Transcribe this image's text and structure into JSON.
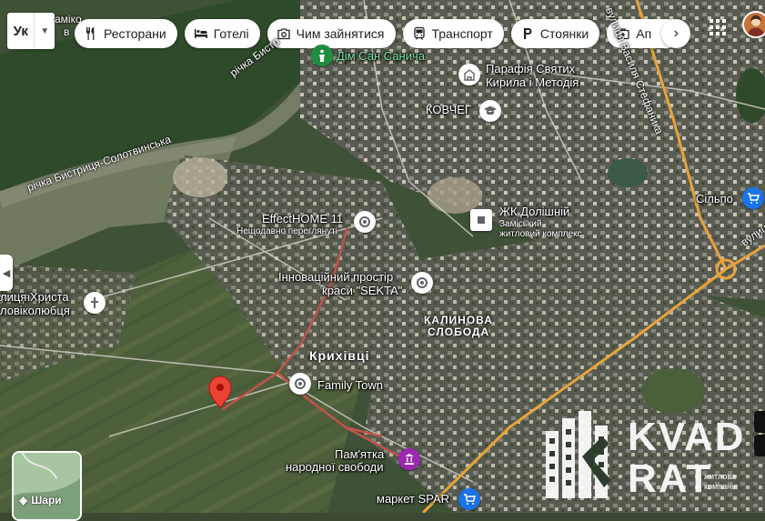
{
  "language": {
    "code": "Ук"
  },
  "chips": [
    {
      "label": "Ресторани",
      "icon": "fork-knife-icon"
    },
    {
      "label": "Готелі",
      "icon": "bed-icon"
    },
    {
      "label": "Чим зайнятися",
      "icon": "camera-icon"
    },
    {
      "label": "Транспорт",
      "icon": "train-icon"
    },
    {
      "label": "Стоянки",
      "icon": "parking-icon"
    },
    {
      "label": "Ап",
      "icon": "medical-bag-icon"
    }
  ],
  "pois": {
    "dim": "Дім Сан Санича",
    "parafiya_1": "Парафія Святих",
    "parafiya_2": "Кирила і Методія",
    "kovcheg": "КОВЧЕГ",
    "effect": "EffectHOME 11",
    "effect_sub": "Нещодавно переглянуті",
    "innov_1": "Інноваційний простір",
    "innov_2": "краси \"SEKTA\"",
    "zhk": "ЖК Долішній",
    "zhk_sub_1": "Заміський",
    "zhk_sub_2": "житловий комплекс",
    "silpo": "Сільпо",
    "church_1": "лиця Христа",
    "church_2": "ловіколюбця",
    "family": "Family Town",
    "pamyatka_1": "Пам'ятка",
    "pamyatka_2": "народної свободи",
    "spar": "маркет SPAR",
    "top_left_1": "аміко",
    "top_left_2": "в"
  },
  "places": {
    "krykhivtsi": "Крихівці",
    "district_1": "КАЛИНОВА",
    "district_2": "СЛОБОДА"
  },
  "roads": {
    "river_1": "річка Бистриця-Солотвинська",
    "river_2": "річка Бистр",
    "street_1": "вулиця Василя Стефаника",
    "street_2": "вулиц",
    "street_3": "улиця"
  },
  "layers": {
    "label": "Шари"
  },
  "watermark": {
    "line1": "KVAD",
    "line2": "RAT",
    "small_1": "житлова",
    "small_2": "компанія"
  },
  "colors": {
    "pin_red": "#ea4335",
    "route": "#c2534a",
    "road_yellow": "#e8a33a",
    "poi_blue": "#1a73e8",
    "poi_purple": "#9c27b0",
    "poi_green": "#1e8e3e"
  }
}
